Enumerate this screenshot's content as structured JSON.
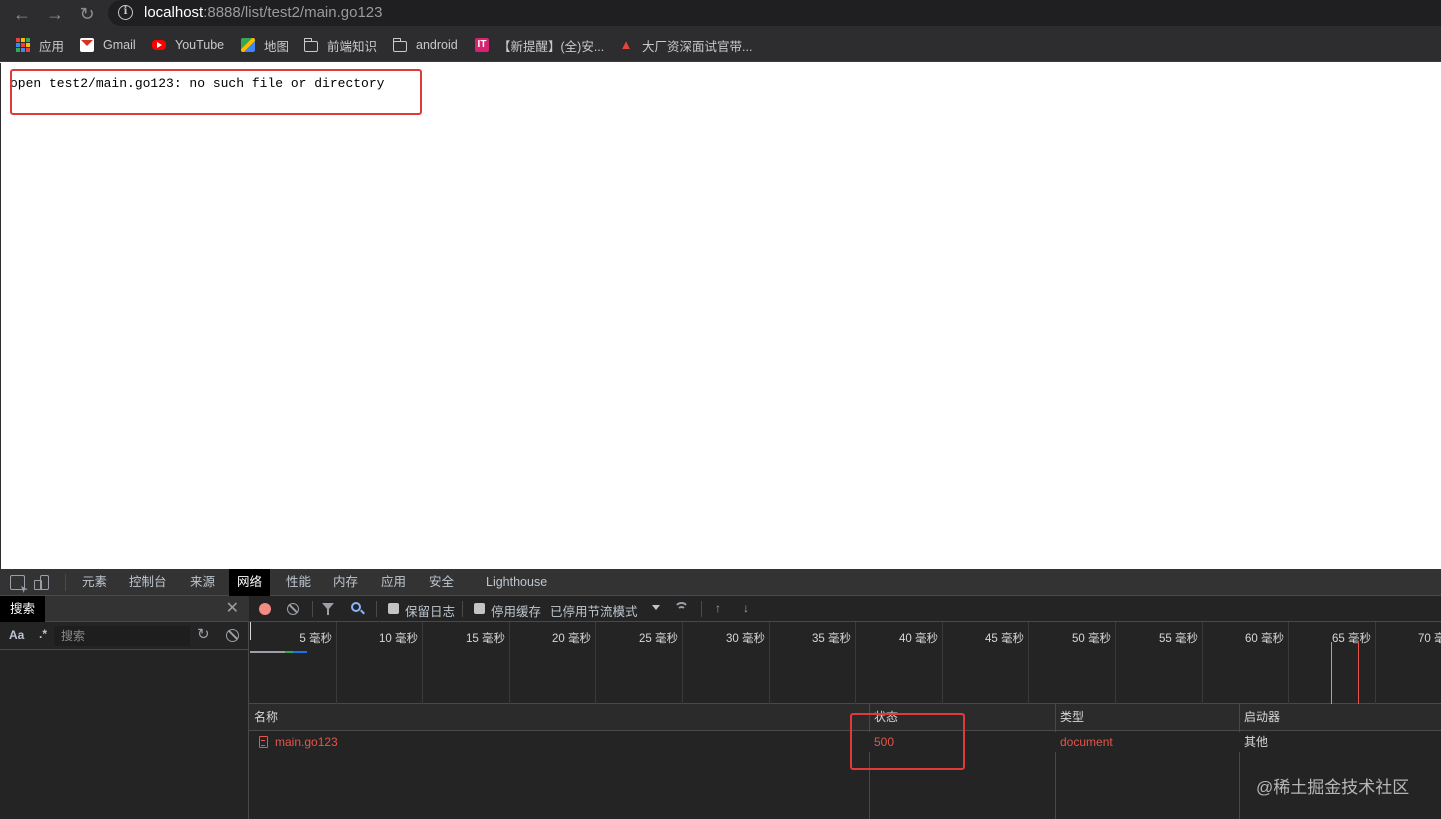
{
  "browser": {
    "url_host": "localhost",
    "url_rest": ":8888/list/test2/main.go123",
    "nav": {
      "back_icon": "arrow-left-icon",
      "forward_icon": "arrow-right-icon",
      "reload_icon": "reload-icon"
    },
    "bookmarks": [
      {
        "label": "应用",
        "icon": "apps-grid-icon"
      },
      {
        "label": "Gmail",
        "icon": "gmail-icon"
      },
      {
        "label": "YouTube",
        "icon": "youtube-icon"
      },
      {
        "label": "地图",
        "icon": "maps-icon"
      },
      {
        "label": "前端知识",
        "icon": "folder-icon"
      },
      {
        "label": "android",
        "icon": "folder-icon"
      },
      {
        "label": "【新提醒】(全)安...",
        "icon": "it-badge-icon"
      },
      {
        "label": "大厂资深面试官带...",
        "icon": "fire-icon"
      }
    ]
  },
  "page": {
    "error_message": "open test2/main.go123: no such file or directory"
  },
  "devtools": {
    "tabs": [
      "元素",
      "控制台",
      "来源",
      "网络",
      "性能",
      "内存",
      "应用",
      "安全",
      "Lighthouse"
    ],
    "active_tab": "网络",
    "search_pane": {
      "title": "搜索",
      "case_toggle": "Aa",
      "regex_toggle": ".*",
      "placeholder": "搜索"
    },
    "network_toolbar": {
      "preserve_log": "保留日志",
      "disable_cache": "停用缓存",
      "throttling": "已停用节流模式"
    },
    "timeline_ticks": [
      "5 毫秒",
      "10 毫秒",
      "15 毫秒",
      "20 毫秒",
      "25 毫秒",
      "30 毫秒",
      "35 毫秒",
      "40 毫秒",
      "45 毫秒",
      "50 毫秒",
      "55 毫秒",
      "60 毫秒",
      "65 毫秒",
      "70 毫秒"
    ],
    "columns": [
      "名称",
      "状态",
      "类型",
      "启动器"
    ],
    "requests": [
      {
        "name": "main.go123",
        "status": "500",
        "type": "document",
        "initiator": "其他"
      }
    ],
    "colors": {
      "error_red": "#e8534a",
      "highlight_red": "#e03b3b",
      "active_tab_bg": "#000000"
    }
  },
  "watermark": "@稀土掘金技术社区"
}
